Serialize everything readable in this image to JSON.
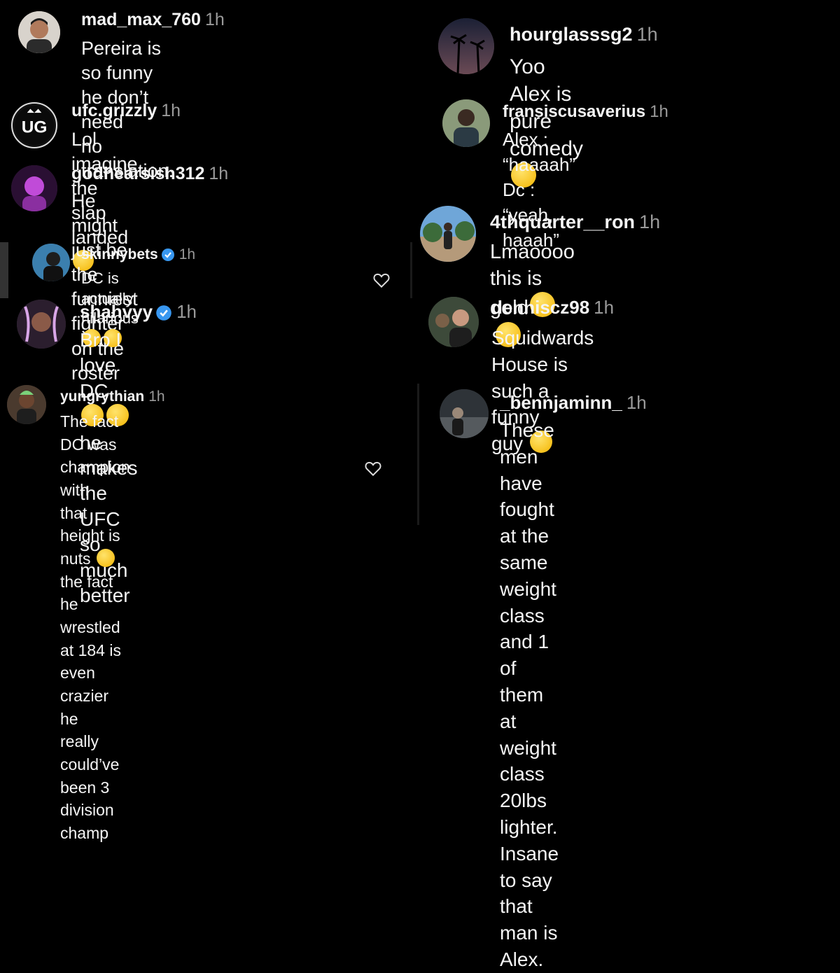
{
  "emoji_color": "#f4b400",
  "comments": [
    {
      "username": "mad_max_760",
      "time": "1h",
      "verified": false,
      "lines": [
        "Pereira is so funny he don’t need",
        "no translation."
      ]
    },
    {
      "username": "ufc.grizzly",
      "time": "1h",
      "verified": false,
      "lines": [
        "Lol imagine the slap landed"
      ]
    },
    {
      "username": "godhearsish312",
      "time": "1h",
      "verified": false,
      "lines": [
        "He might just be the funniest",
        "fighter on the roster"
      ]
    },
    {
      "username": "skinnybets",
      "time": "1h",
      "verified": true,
      "lines": [
        "DC is actually hilarious"
      ]
    },
    {
      "username": "shahvyy",
      "time": "1h",
      "verified": true,
      "lines": [
        "Bro I love DC",
        "he makes the",
        "UFC so much better"
      ]
    },
    {
      "username": "yungrythian",
      "time": "1h",
      "verified": false,
      "lines": [
        "The fact DC was champion with",
        "that height is nuts",
        "the fact he",
        "wrestled at 184 is even crazier he",
        "really could’ve been 3 division",
        "champ"
      ]
    },
    {
      "username": "hourglasssg2",
      "time": "1h",
      "verified": false,
      "lines": [
        "Yoo Alex is pure comedy"
      ]
    },
    {
      "username": "fransiscusaverius",
      "time": "1h",
      "verified": false,
      "lines": [
        "Alex : “haaaah”",
        "Dc : “yeah, haaah”"
      ]
    },
    {
      "username": "4thquarter__ron",
      "time": "1h",
      "verified": false,
      "lines": [
        "Lmaoooo this is gold"
      ]
    },
    {
      "username": "denniscz98",
      "time": "1h",
      "verified": false,
      "lines": [
        "Squidwards House is such a funny",
        "guy"
      ]
    },
    {
      "username": "_bennjaminn_",
      "time": "1h",
      "verified": false,
      "lines": [
        "These men have fought at the",
        "same weight class and 1 of them",
        "at weight class 20lbs lighter.",
        "Insane to say that man is Alex."
      ]
    }
  ],
  "icons": {
    "like": "heart-outline-icon",
    "verified": "verified-badge-icon",
    "emoji": "face-with-tears-of-joy-icon",
    "crying": "loudly-crying-face-icon"
  }
}
